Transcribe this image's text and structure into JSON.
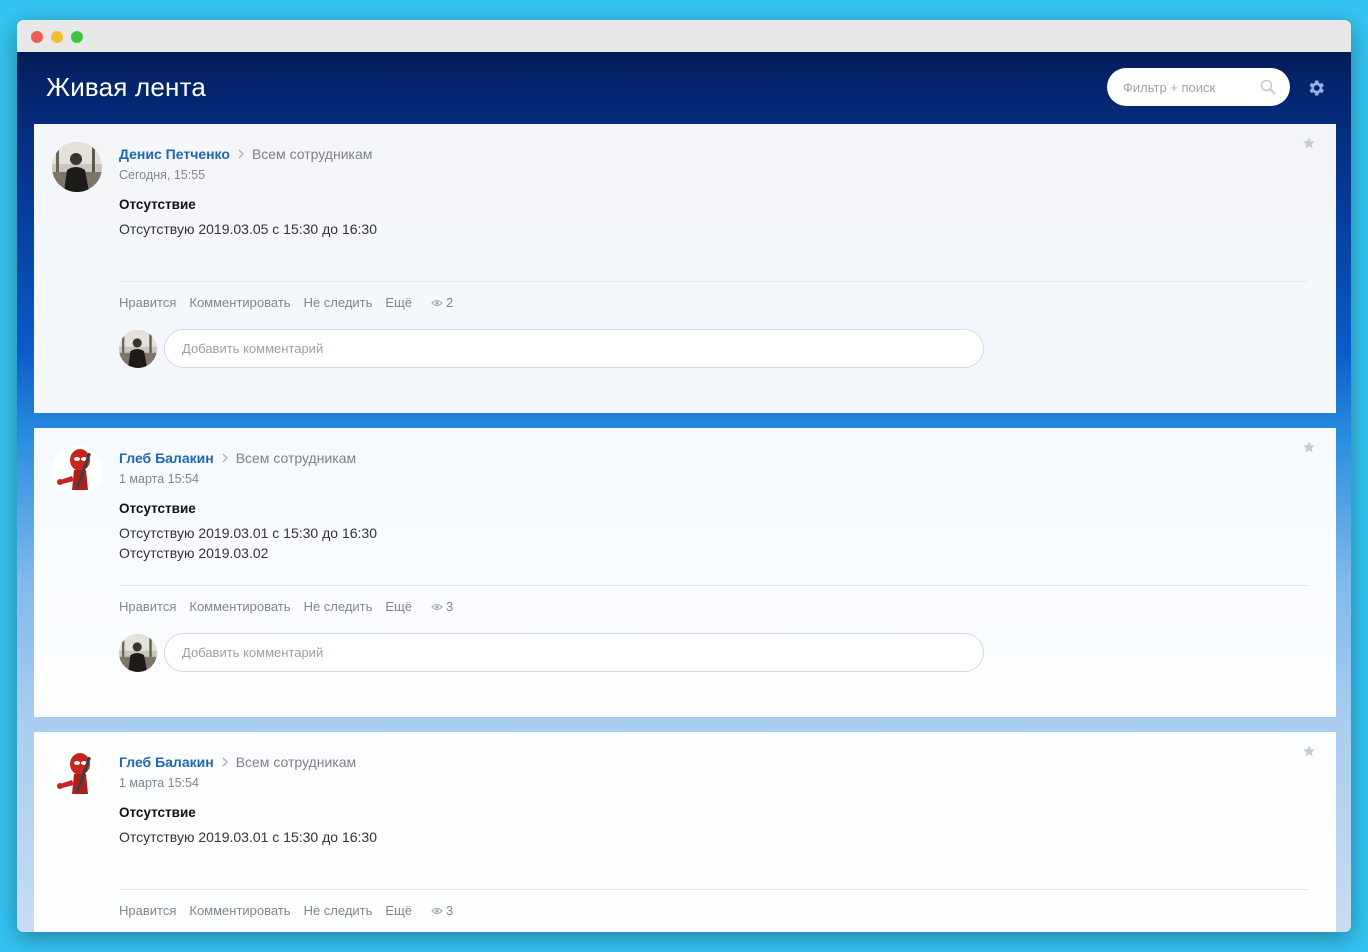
{
  "header": {
    "title": "Живая лента",
    "search_placeholder": "Фильтр + поиск"
  },
  "posts": [
    {
      "author": "Денис Петченко",
      "destination": "Всем сотрудникам",
      "date": "Сегодня, 15:55",
      "title": "Отсутствие",
      "lines": [
        "Отсутствую 2019.03.05 с 15:30 до 16:30"
      ],
      "actions": {
        "like": "Нравится",
        "comment": "Комментировать",
        "unfollow": "Не следить",
        "more": "Ещё"
      },
      "views": "2",
      "comment_placeholder": "Добавить комментарий",
      "avatar": "photo-man"
    },
    {
      "author": "Глеб Балакин",
      "destination": "Всем сотрудникам",
      "date": "1 марта 15:54",
      "title": "Отсутствие",
      "lines": [
        "Отсутствую 2019.03.01 с 15:30 до 16:30",
        "Отсутствую 2019.03.02"
      ],
      "actions": {
        "like": "Нравится",
        "comment": "Комментировать",
        "unfollow": "Не следить",
        "more": "Ещё"
      },
      "views": "3",
      "comment_placeholder": "Добавить комментарий",
      "avatar": "deadpool"
    },
    {
      "author": "Глеб Балакин",
      "destination": "Всем сотрудникам",
      "date": "1 марта 15:54",
      "title": "Отсутствие",
      "lines": [
        "Отсутствую 2019.03.01 с 15:30 до 16:30"
      ],
      "actions": {
        "like": "Нравится",
        "comment": "Комментировать",
        "unfollow": "Не следить",
        "more": "Ещё"
      },
      "views": "3",
      "avatar": "deadpool"
    }
  ],
  "icons": {
    "search": "search-icon",
    "settings": "gear-icon",
    "favorite": "star-icon",
    "views": "eye-icon",
    "separator": "chevron-right-icon"
  },
  "colors": {
    "author_link": "#2067b0",
    "meta_text": "#80868e"
  }
}
